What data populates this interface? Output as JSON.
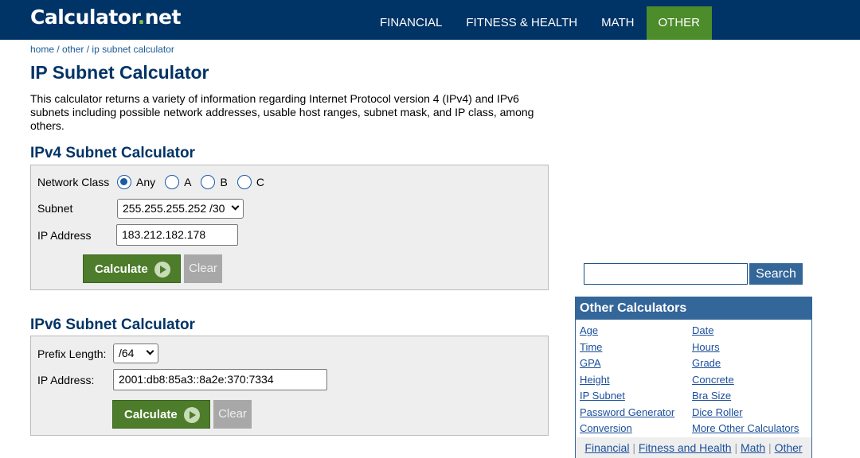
{
  "header": {
    "logo_main": "Calculator",
    "logo_dot": ".",
    "logo_suffix": "net",
    "nav": [
      {
        "label": "FINANCIAL"
      },
      {
        "label": "FITNESS & HEALTH"
      },
      {
        "label": "MATH"
      },
      {
        "label": "OTHER",
        "active": true
      }
    ]
  },
  "breadcrumb": [
    "home",
    "other",
    "ip subnet calculator"
  ],
  "page_title": "IP Subnet Calculator",
  "intro": "This calculator returns a variety of information regarding Internet Protocol version 4 (IPv4) and IPv6 subnets including possible network addresses, usable host ranges, subnet mask, and IP class, among others.",
  "ipv4": {
    "title": "IPv4 Subnet Calculator",
    "network_class_label": "Network Class",
    "network_class_options": [
      "Any",
      "A",
      "B",
      "C"
    ],
    "network_class_selected": "Any",
    "subnet_label": "Subnet",
    "subnet_value": "255.255.255.252 /30",
    "ip_label": "IP Address",
    "ip_value": "183.212.182.178",
    "calculate_label": "Calculate",
    "clear_label": "Clear"
  },
  "ipv6": {
    "title": "IPv6 Subnet Calculator",
    "prefix_label": "Prefix Length:",
    "prefix_value": "/64",
    "ip_label": "IP Address:",
    "ip_value": "2001:db8:85a3::8a2e:370:7334",
    "calculate_label": "Calculate",
    "clear_label": "Clear"
  },
  "search": {
    "value": "",
    "button_label": "Search"
  },
  "other_calculators": {
    "title": "Other Calculators",
    "left": [
      "Age",
      "Time",
      "GPA",
      "Height",
      "IP Subnet",
      "Password Generator",
      "Conversion"
    ],
    "right": [
      "Date",
      "Hours",
      "Grade",
      "Concrete",
      "Bra Size",
      "Dice Roller",
      "More Other Calculators"
    ],
    "footer": [
      "Financial",
      "Fitness and Health",
      "Math",
      "Other"
    ],
    "footer_sep": "|"
  },
  "colors": {
    "header_bg": "#003366",
    "nav_active": "#4d8c2b",
    "title": "#003366",
    "calculate_btn": "#4d7c2a",
    "sidebar_accent": "#336699"
  }
}
